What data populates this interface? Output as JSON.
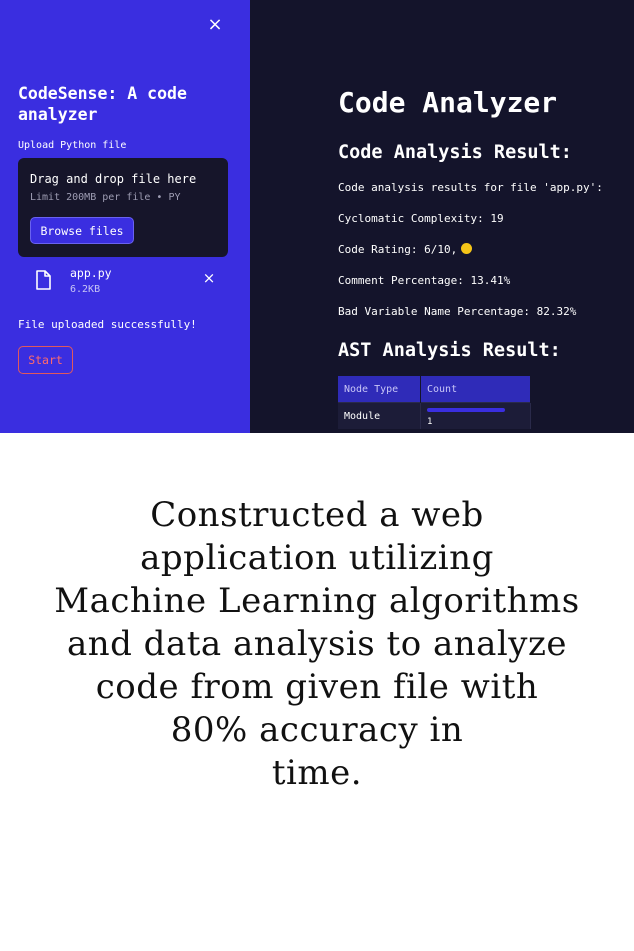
{
  "sidebar": {
    "close_glyph": "×",
    "title": "CodeSense: A code analyzer",
    "upload_label": "Upload Python file",
    "dropzone": {
      "title": "Drag and drop file here",
      "limit": "Limit 200MB per file • PY",
      "browse_label": "Browse files"
    },
    "file": {
      "name": "app.py",
      "size": "6.2KB",
      "remove_glyph": "×",
      "icon": "file-icon"
    },
    "upload_message": "File uploaded successfully!",
    "start_label": "Start"
  },
  "main": {
    "title": "Code Analyzer",
    "result_heading": "Code Analysis Result:",
    "results_for": "Code analysis results for file 'app.py':",
    "cyclomatic": "Cyclomatic Complexity: 19",
    "rating": "Code Rating: 6/10,",
    "comment_pct": "Comment Percentage: 13.41%",
    "bad_var_pct": "Bad Variable Name Percentage: 82.32%",
    "ast_heading": "AST Analysis Result:",
    "table": {
      "headers": [
        "Node Type",
        "Count"
      ],
      "rows": [
        {
          "node_type": "Module",
          "count": "1",
          "bar_fraction": 1.0
        }
      ]
    }
  },
  "caption": {
    "lines": [
      "Constructed a web",
      "application utilizing",
      "Machine Learning algorithms",
      "and data analysis to analyze",
      "code from given file with",
      "80% accuracy in",
      "time."
    ]
  },
  "colors": {
    "sidebar_bg": "#3a2ee0",
    "main_bg": "#14142b",
    "dropzone_bg": "#16152a",
    "rating_dot": "#f5c518",
    "start_accent": "#ff6b6b"
  }
}
